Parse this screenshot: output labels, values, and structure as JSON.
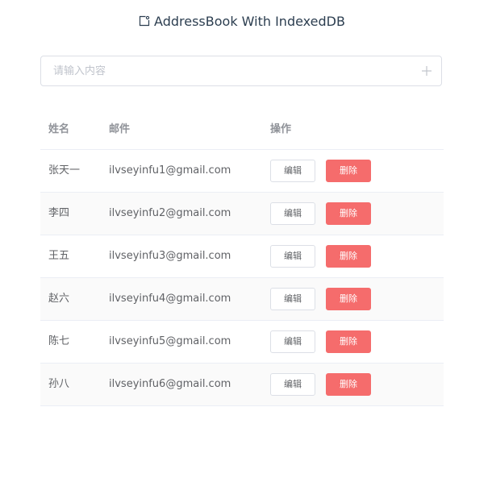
{
  "header": {
    "title": "AddressBook With IndexedDB",
    "icon": "contact-card-icon"
  },
  "search": {
    "placeholder": "请输入内容",
    "value": "",
    "add_icon": "plus-icon"
  },
  "table": {
    "columns": [
      "姓名",
      "邮件",
      "操作"
    ],
    "rows": [
      {
        "name": "张天一",
        "email": "ilvseyinfu1@gmail.com",
        "edit": "编辑",
        "delete": "删除"
      },
      {
        "name": "李四",
        "email": "ilvseyinfu2@gmail.com",
        "edit": "编辑",
        "delete": "删除"
      },
      {
        "name": "王五",
        "email": "ilvseyinfu3@gmail.com",
        "edit": "编辑",
        "delete": "删除"
      },
      {
        "name": "赵六",
        "email": "ilvseyinfu4@gmail.com",
        "edit": "编辑",
        "delete": "删除"
      },
      {
        "name": "陈七",
        "email": "ilvseyinfu5@gmail.com",
        "edit": "编辑",
        "delete": "删除"
      },
      {
        "name": "孙八",
        "email": "ilvseyinfu6@gmail.com",
        "edit": "编辑",
        "delete": "删除"
      }
    ]
  },
  "colors": {
    "danger": "#f56c6c",
    "border": "#ebeef5",
    "stripe": "#fafafa",
    "text": "#606266",
    "header_text": "#909399"
  }
}
